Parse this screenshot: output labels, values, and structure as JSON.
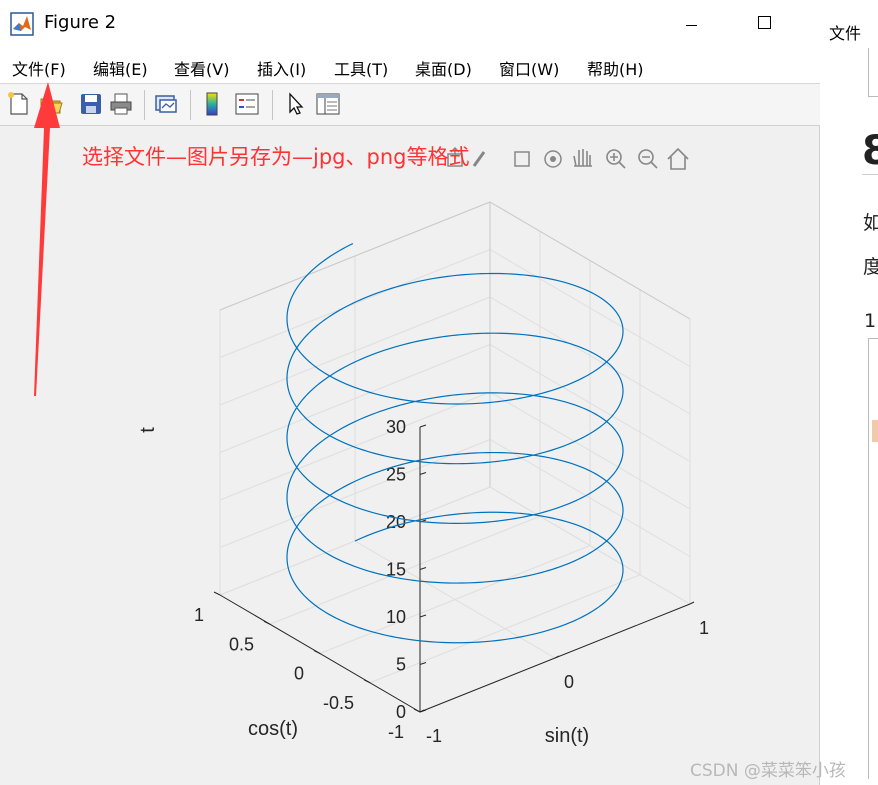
{
  "window": {
    "title": "Figure 2",
    "icon": "matlab-logo-icon"
  },
  "menubar": {
    "items": [
      {
        "label": "文件(F)"
      },
      {
        "label": "编辑(E)"
      },
      {
        "label": "查看(V)"
      },
      {
        "label": "插入(I)"
      },
      {
        "label": "工具(T)"
      },
      {
        "label": "桌面(D)"
      },
      {
        "label": "窗口(W)"
      },
      {
        "label": "帮助(H)"
      }
    ]
  },
  "toolbar": {
    "icons": [
      "new-figure-icon",
      "open-file-icon",
      "save-icon",
      "print-icon",
      "link-plot-icon",
      "colorbar-icon",
      "legend-icon",
      "edit-plot-arrow-icon",
      "property-inspector-icon"
    ]
  },
  "axes_toolbar": {
    "icons": [
      "export-icon",
      "brush-icon",
      "data-tips-icon",
      "rotate-3d-icon",
      "pan-hand-icon",
      "zoom-in-icon",
      "zoom-out-icon",
      "home-icon"
    ]
  },
  "annotation": {
    "text": "选择文件—图片另存为—jpg、png等格式",
    "color": "#ff3333"
  },
  "chart_data": {
    "type": "line3d",
    "title": "",
    "xlabel": "sin(t)",
    "ylabel": "cos(t)",
    "zlabel": "t",
    "xlim": [
      -1,
      1
    ],
    "ylim": [
      -1,
      1
    ],
    "zlim": [
      0,
      30
    ],
    "x_ticks": [
      "-1",
      "0",
      "1"
    ],
    "y_ticks": [
      "-1",
      "-0.5",
      "0",
      "0.5",
      "1"
    ],
    "z_ticks": [
      "0",
      "5",
      "10",
      "15",
      "20",
      "25",
      "30"
    ],
    "grid": true,
    "view": {
      "azimuth": -37.5,
      "elevation": 30
    },
    "series": [
      {
        "x_expr": "sin(t)",
        "y_expr": "cos(t)",
        "z_expr": "t",
        "t_range": [
          0,
          31.4
        ],
        "color": "#0072bd"
      }
    ]
  },
  "right_panel": {
    "menu_label": "文件",
    "heading_char": "8",
    "line1": "如",
    "line2": "度",
    "line3": "1"
  },
  "watermark": "CSDN @菜菜笨小孩"
}
